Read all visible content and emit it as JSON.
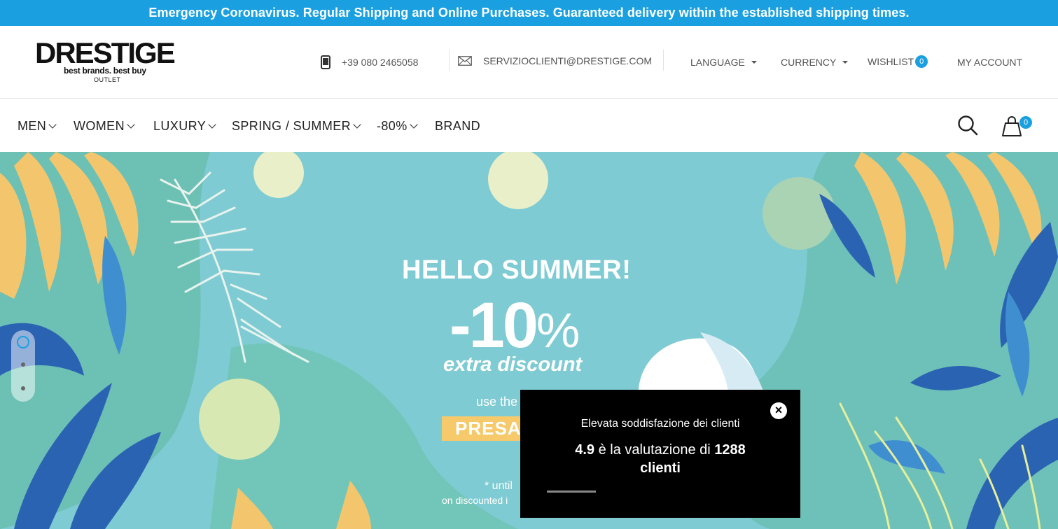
{
  "announcement": "Emergency Coronavirus. Regular Shipping and Online Purchases. Guaranteed delivery within the established shipping times.",
  "logo": {
    "name": "DRESTIGE",
    "tagline": "best brands. best buy",
    "sub": "OUTLET"
  },
  "contact": {
    "phone": "+39 080 2465058",
    "email": "SERVIZIOCLIENTI@DRESTIGE.COM"
  },
  "toplinks": {
    "language": "LANGUAGE",
    "currency": "CURRENCY",
    "wishlist": "WISHLIST",
    "wishlist_count": "0",
    "account": "MY ACCOUNT"
  },
  "nav": {
    "men": "MEN",
    "women": "WOMEN",
    "luxury": "LUXURY",
    "spring_summer": "SPRING / SUMMER",
    "minus80": "-80%",
    "brand": "BRAND"
  },
  "cart_count": "0",
  "hero": {
    "headline": "HELLO SUMMER!",
    "discount": "-10",
    "percent": "%",
    "extra": "extra discount",
    "use_the": "use the",
    "code": "PRESA",
    "until": "* until",
    "on_discounted": "on discounted i"
  },
  "popup": {
    "line1": "Elevata soddisfazione dei clienti",
    "rating": "4.9",
    "mid": " è la valutazione di ",
    "count": "1288",
    "end": "clienti",
    "close": "×"
  },
  "colors": {
    "accent": "#1aa0e0",
    "hero_bg": "#7fcbd3",
    "code_bg": "#f6c96a"
  }
}
